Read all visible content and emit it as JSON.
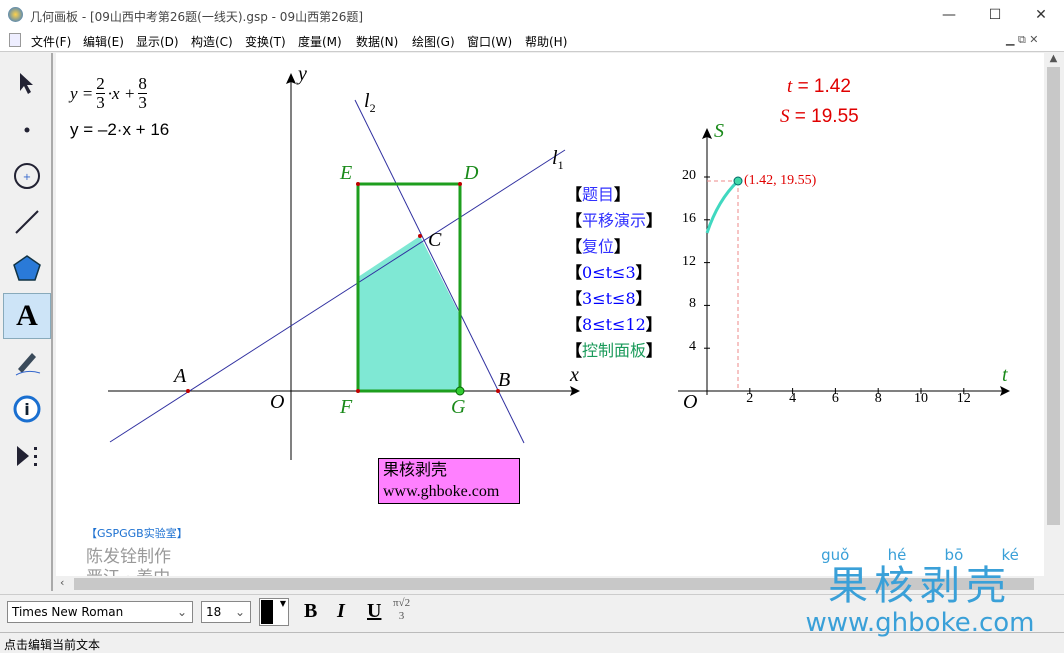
{
  "window": {
    "title": "几何画板 - [09山西中考第26题(一线天).gsp - 09山西第26题]",
    "minimize": "—",
    "maximize": "☐",
    "close": "✕"
  },
  "menu": [
    "文件(F)",
    "编辑(E)",
    "显示(D)",
    "构造(C)",
    "变换(T)",
    "度量(M)",
    "数据(N)",
    "绘图(G)",
    "窗口(W)",
    "帮助(H)"
  ],
  "tools": [
    "arrow-tool",
    "point-tool",
    "compass-tool",
    "straightedge-tool",
    "polygon-tool",
    "text-tool",
    "marker-tool",
    "information-tool",
    "custom-tool"
  ],
  "canvas": {
    "eq1": {
      "y": "y =",
      "num1": "2",
      "den1": "3",
      "mid": "·x +",
      "num2": "8",
      "den2": "3"
    },
    "eq2": "y = –2·x + 16",
    "points": {
      "A": "A",
      "B": "B",
      "C": "C",
      "D": "D",
      "E": "E",
      "F": "F",
      "G": "G",
      "O": "O"
    },
    "axes": {
      "x": "x",
      "y": "y"
    },
    "lines": {
      "l1": "l",
      "l1sub": "1",
      "l2": "l",
      "l2sub": "2"
    },
    "buttons": [
      {
        "label": "题目",
        "color": "#3030ff"
      },
      {
        "label": "平移演示",
        "color": "#3030ff"
      },
      {
        "label": "复位",
        "color": "#3030ff"
      },
      {
        "label": "0≤t≤3",
        "color": "#0000ff"
      },
      {
        "label": "3≤t≤8",
        "color": "#0000ff"
      },
      {
        "label": "8≤t≤12",
        "color": "#0000ff"
      },
      {
        "label": "控制面板",
        "color": "#1a9a5a"
      }
    ],
    "t_readout": {
      "name": "t",
      "value": "= 1.42"
    },
    "S_readout": {
      "name": "S",
      "value": "= 19.55"
    },
    "graph": {
      "xlabel": "t",
      "ylabel": "S",
      "origin": "O",
      "xticks": [
        "2",
        "4",
        "6",
        "8",
        "10",
        "12"
      ],
      "yticks": [
        "4",
        "8",
        "12",
        "16",
        "20"
      ],
      "point_label": "(1.42, 19.55)"
    },
    "watermark_box": {
      "line1": "果核剥壳",
      "line2": "www.ghboke.com"
    },
    "credit": {
      "lab": "【GSPGGB实验室】",
      "author": "陈发铨制作",
      "place": "晋江 · 养中"
    },
    "logo": {
      "pinyin": [
        "guǒ",
        "hé",
        "bō",
        "ké"
      ],
      "chars": "果核剥壳",
      "url": "www.ghboke.com"
    }
  },
  "colors": {
    "rect": "#1e9e1e",
    "fill": "#7fe8d4",
    "line": "#3030a0",
    "red": "#e00000",
    "green": "#1a8a1a"
  },
  "texttoolbar": {
    "font": "Times New Roman",
    "size": "18",
    "bold": "B",
    "italic": "I",
    "underline": "U"
  },
  "status": "点击编辑当前文本"
}
